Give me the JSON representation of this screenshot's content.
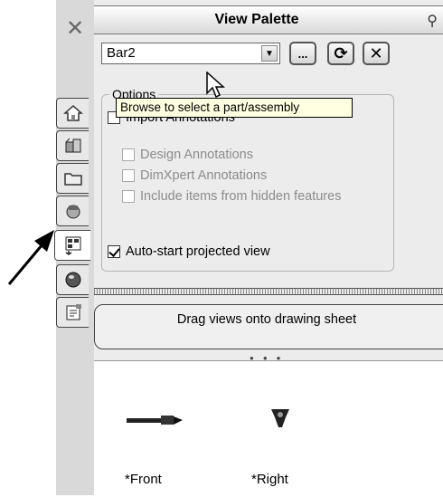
{
  "sidebar": {
    "close_glyph": "✕",
    "tabs": [
      {
        "icon": "home-icon",
        "active": false
      },
      {
        "icon": "3d-part-icon",
        "active": false
      },
      {
        "icon": "folder-icon",
        "active": false
      },
      {
        "icon": "appearance-icon",
        "active": false
      },
      {
        "icon": "view-palette-icon",
        "active": true
      },
      {
        "icon": "scene-sphere-icon",
        "active": false
      },
      {
        "icon": "properties-icon",
        "active": false
      }
    ]
  },
  "panel": {
    "title": "View Palette"
  },
  "toolbar": {
    "combo_value": "Bar2",
    "browse_label": "...",
    "refresh_glyph": "⟳",
    "clear_glyph": "✕"
  },
  "tooltip": {
    "text": "Browse to select a part/assembly"
  },
  "options": {
    "legend": "Options",
    "import_annotations": {
      "label": "Import Annotations",
      "checked": false,
      "enabled": true
    },
    "design_annotations": {
      "label": "Design Annotations",
      "checked": false,
      "enabled": false
    },
    "dimxpert_annotations": {
      "label": "DimXpert Annotations",
      "checked": false,
      "enabled": false
    },
    "hidden_features": {
      "label": "Include items from hidden features",
      "checked": false,
      "enabled": false
    },
    "auto_start": {
      "label": "Auto-start projected view",
      "checked": true,
      "enabled": true
    }
  },
  "drag_message": "Drag views onto drawing sheet",
  "views": [
    {
      "label": "*Front"
    },
    {
      "label": "*Right"
    }
  ]
}
